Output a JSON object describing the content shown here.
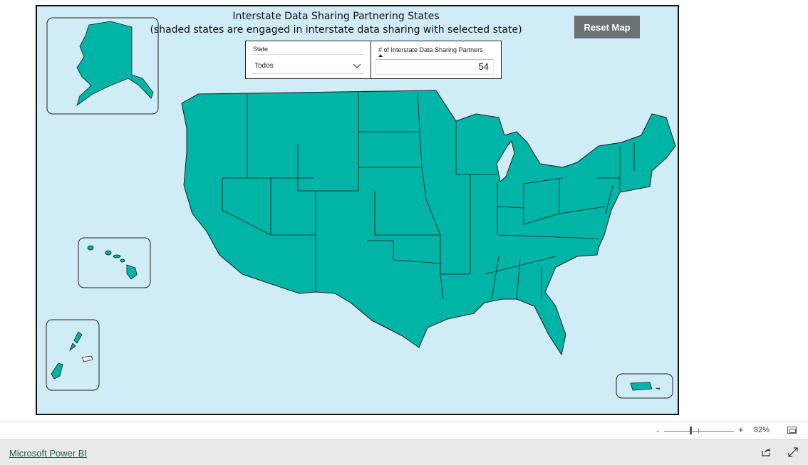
{
  "report": {
    "title_line1": "Interstate Data Sharing Partnering States",
    "title_line2": "(shaded states are engaged in interstate data sharing with selected state)",
    "reset_button": "Reset Map"
  },
  "slicer": {
    "label": "State",
    "selected": "Todos"
  },
  "card": {
    "label": "# of Interstate Data Sharing Partners",
    "value": "54"
  },
  "map": {
    "shaded_color": "#00b5a6",
    "unshaded_color": "#ffffff",
    "background_color": "#d0ecf6",
    "outline_color": "#1a1a1a"
  },
  "zoom": {
    "minus": "-",
    "plus": "+",
    "percent": "82%"
  },
  "footer": {
    "link": "Microsoft Power BI"
  },
  "icons": [
    "chevron-down-icon",
    "fit-to-page-icon",
    "share-icon",
    "expand-icon"
  ]
}
